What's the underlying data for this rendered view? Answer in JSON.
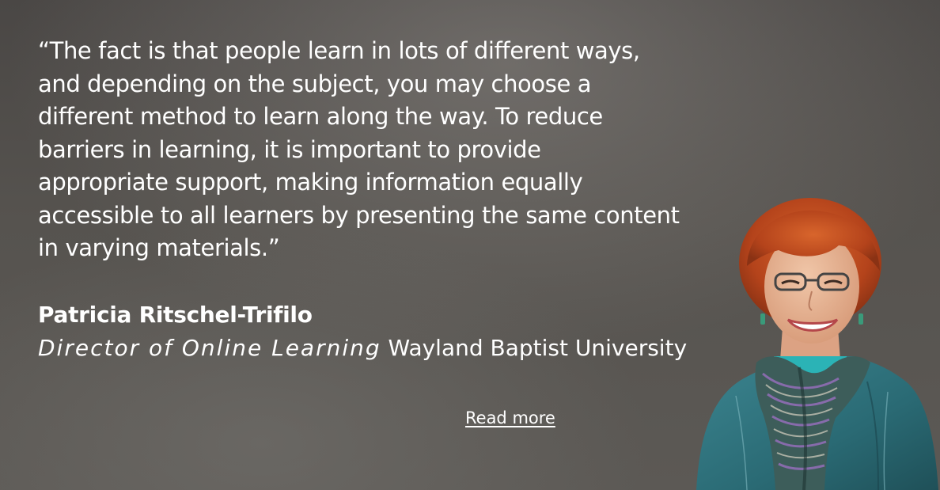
{
  "testimonial": {
    "quote": "“The fact is that people learn in lots of different ways,\nand depending on the subject, you may choose a\ndifferent method to learn along the way. To reduce\nbarriers in learning, it is important to provide\nappropriate support, making information equally\naccessible to all learners by presenting the same content\nin varying materials.”",
    "author_name": "Patricia Ritschel-Trifilo",
    "author_role": "Director of Online Learning",
    "author_org": "Wayland Baptist University",
    "read_more_label": "Read more"
  },
  "colors": {
    "text": "#ffffff",
    "background": "#55524e",
    "jacket": "#2f6f78",
    "hair": "#b8471c"
  },
  "icons": {
    "portrait": "author-portrait-photo"
  }
}
